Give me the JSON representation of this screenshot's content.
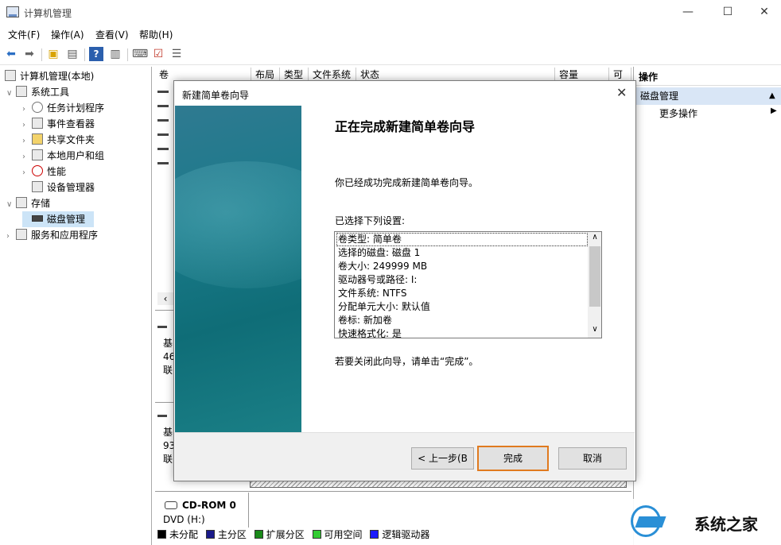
{
  "window": {
    "title": "计算机管理",
    "minimize": "—",
    "maximize": "☐",
    "close": "✕"
  },
  "menu": [
    "文件(F)",
    "操作(A)",
    "查看(V)",
    "帮助(H)"
  ],
  "toolbar_icons": [
    "back-arrow-icon",
    "forward-arrow-icon",
    "up-folder-icon",
    "properties-icon",
    "help-icon",
    "pane-icon",
    "connect-icon",
    "check-icon",
    "list-icon"
  ],
  "tree": {
    "root": "计算机管理(本地)",
    "items": [
      {
        "label": "系统工具",
        "level": 1,
        "expanded": true,
        "icon": "tools-icon"
      },
      {
        "label": "任务计划程序",
        "level": 2,
        "icon": "clock-icon"
      },
      {
        "label": "事件查看器",
        "level": 2,
        "icon": "event-viewer-icon"
      },
      {
        "label": "共享文件夹",
        "level": 2,
        "icon": "shared-folder-icon"
      },
      {
        "label": "本地用户和组",
        "level": 2,
        "icon": "users-icon"
      },
      {
        "label": "性能",
        "level": 2,
        "icon": "performance-icon"
      },
      {
        "label": "设备管理器",
        "level": 2,
        "icon": "device-manager-icon"
      },
      {
        "label": "存储",
        "level": 1,
        "expanded": true,
        "icon": "storage-icon"
      },
      {
        "label": "磁盘管理",
        "level": 2,
        "selected": true,
        "icon": "disk-icon"
      },
      {
        "label": "服务和应用程序",
        "level": 1,
        "icon": "services-icon"
      }
    ]
  },
  "columns": [
    "卷",
    "布局",
    "类型",
    "文件系统",
    "状态",
    "容量",
    "可"
  ],
  "disk_rows": [
    {
      "line1": "基",
      "line2": "46",
      "line3": "联"
    },
    {
      "line1": "基",
      "line2": "93",
      "line3": "联"
    }
  ],
  "cdrom": {
    "name": "CD-ROM 0",
    "type": "DVD (H:)"
  },
  "legend": [
    {
      "label": "未分配",
      "color": "#000000"
    },
    {
      "label": "主分区",
      "color": "#1a1a8a"
    },
    {
      "label": "扩展分区",
      "color": "#1a8a1a"
    },
    {
      "label": "可用空间",
      "color": "#33cc33"
    },
    {
      "label": "逻辑驱动器",
      "color": "#1a1aff"
    }
  ],
  "actions": {
    "header": "操作",
    "section": "磁盘管理",
    "more": "更多操作"
  },
  "wizard": {
    "title": "新建简单卷向导",
    "heading": "正在完成新建简单卷向导",
    "success_text": "你已经成功完成新建简单卷向导。",
    "settings_label": "已选择下列设置:",
    "settings": [
      "卷类型: 简单卷",
      "选择的磁盘: 磁盘 1",
      "卷大小: 249999 MB",
      "驱动器号或路径: I:",
      "文件系统: NTFS",
      "分配单元大小: 默认值",
      "卷标: 新加卷",
      "快速格式化: 是"
    ],
    "close_hint": "若要关闭此向导，请单击“完成”。",
    "back_button": "< 上一步(B",
    "finish_button": "完成",
    "cancel_button": "取消"
  },
  "watermark": "系统之家"
}
